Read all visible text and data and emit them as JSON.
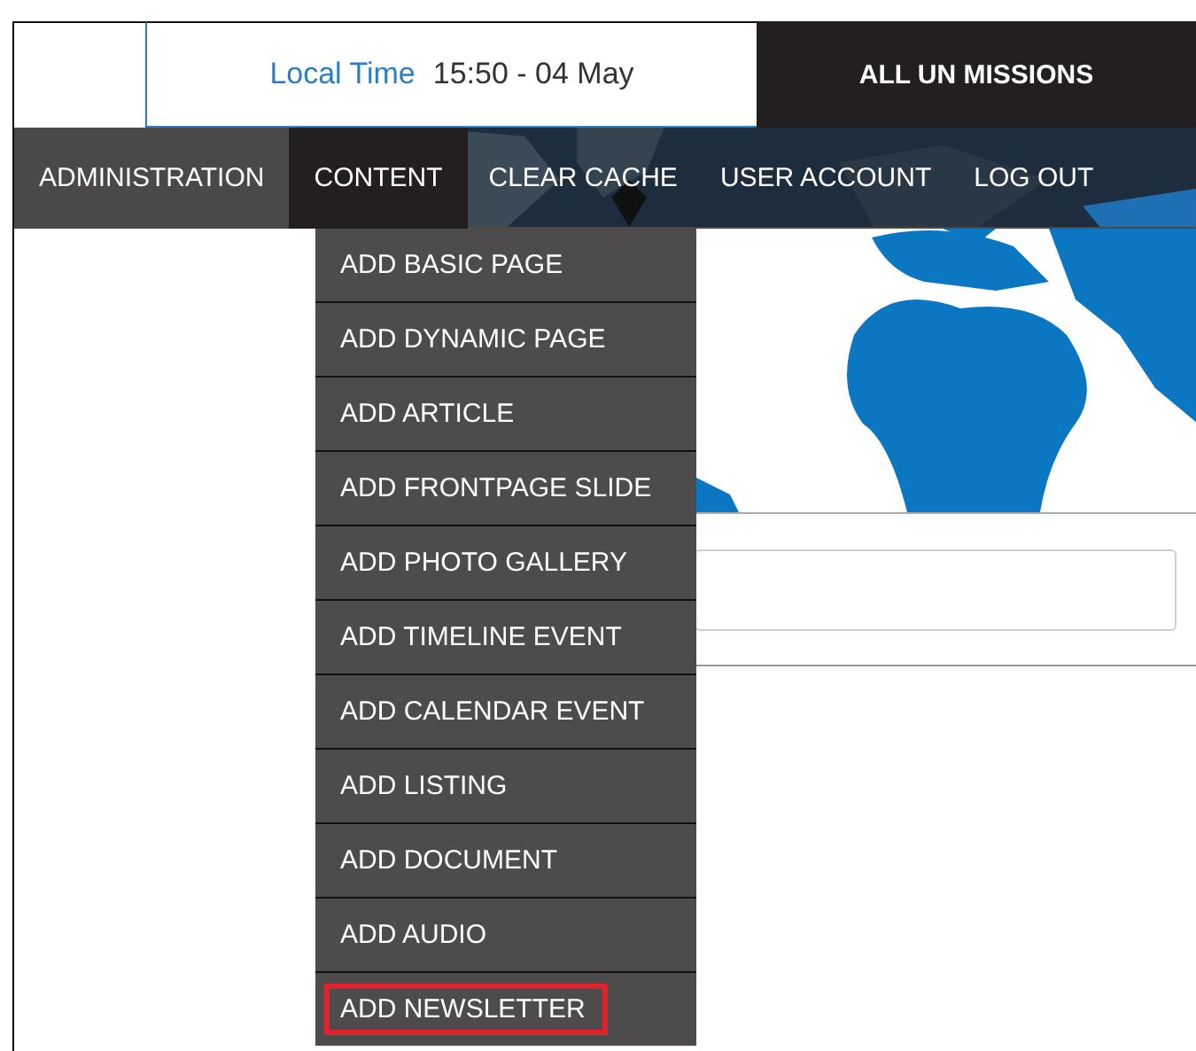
{
  "top_bar": {
    "local_time_label": "Local Time",
    "local_time_value": "15:50 - 04 May",
    "missions_link": "ALL UN MISSIONS"
  },
  "nav": [
    {
      "label": "ADMINISTRATION",
      "selected": false,
      "kind": "plain"
    },
    {
      "label": "CONTENT",
      "selected": true,
      "kind": "plain"
    },
    {
      "label": "CLEAR CACHE",
      "selected": false,
      "kind": "overmap"
    },
    {
      "label": "USER ACCOUNT",
      "selected": false,
      "kind": "overmap"
    },
    {
      "label": "LOG OUT",
      "selected": false,
      "kind": "overmap"
    }
  ],
  "content_menu": [
    {
      "label": "ADD BASIC PAGE",
      "highlighted": false
    },
    {
      "label": "ADD DYNAMIC PAGE",
      "highlighted": false
    },
    {
      "label": "ADD ARTICLE",
      "highlighted": false
    },
    {
      "label": "ADD FRONTPAGE SLIDE",
      "highlighted": false
    },
    {
      "label": "ADD PHOTO GALLERY",
      "highlighted": false
    },
    {
      "label": "ADD TIMELINE EVENT",
      "highlighted": false
    },
    {
      "label": "ADD CALENDAR EVENT",
      "highlighted": false
    },
    {
      "label": "ADD LISTING",
      "highlighted": false
    },
    {
      "label": "ADD DOCUMENT",
      "highlighted": false
    },
    {
      "label": "ADD AUDIO",
      "highlighted": false
    },
    {
      "label": "ADD NEWSLETTER",
      "highlighted": true
    }
  ]
}
